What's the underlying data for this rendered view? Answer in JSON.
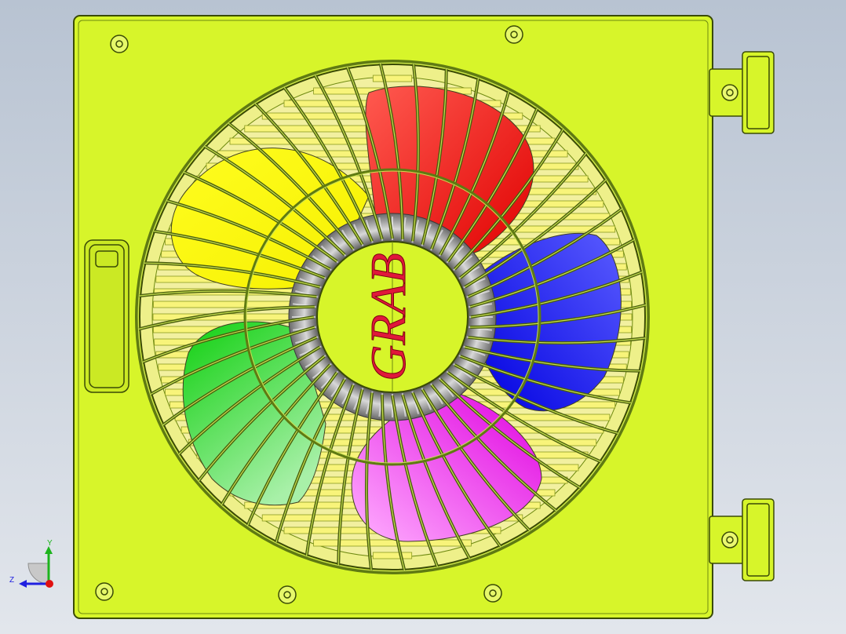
{
  "model": {
    "logo_text": "GRAB",
    "colors": {
      "housing": "#d7f52a",
      "housing_edge": "#3a4a06",
      "guard_wire": "#5f7a12",
      "blade_red": "#ff2a20",
      "blade_blue": "#2a2cff",
      "blade_magenta": "#f020ee",
      "blade_green": "#35e035",
      "blade_yellow": "#ffff00",
      "logo": "#e0183a",
      "hub_ring": "#7a7a7a"
    }
  },
  "triad": {
    "y_label": "Y",
    "z_label": "Z",
    "y_color": "#1db41d",
    "z_color": "#2020e0",
    "x_color": "#e01010"
  }
}
